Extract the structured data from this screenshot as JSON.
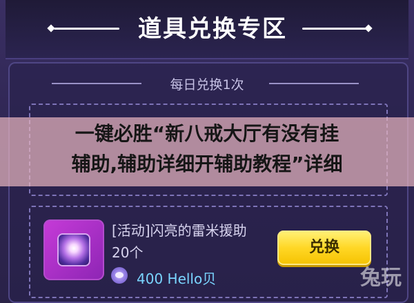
{
  "header": {
    "title": "道具兑换专区"
  },
  "section": {
    "subtitle": "每日兑换1次"
  },
  "item2": {
    "name": "[活动]闪亮的雷米援助",
    "count": "20个",
    "price": "400 Hello贝",
    "button_label": "兑换"
  },
  "banner": {
    "line1": "一键必胜“新八戒大厅有没有挂",
    "line2": "辅助,辅助详细开辅助教程”详细"
  },
  "watermark": "兔玩",
  "colors": {
    "accent": "#ffd726",
    "price": "#7ad5ff",
    "panel": "#2f2653"
  }
}
